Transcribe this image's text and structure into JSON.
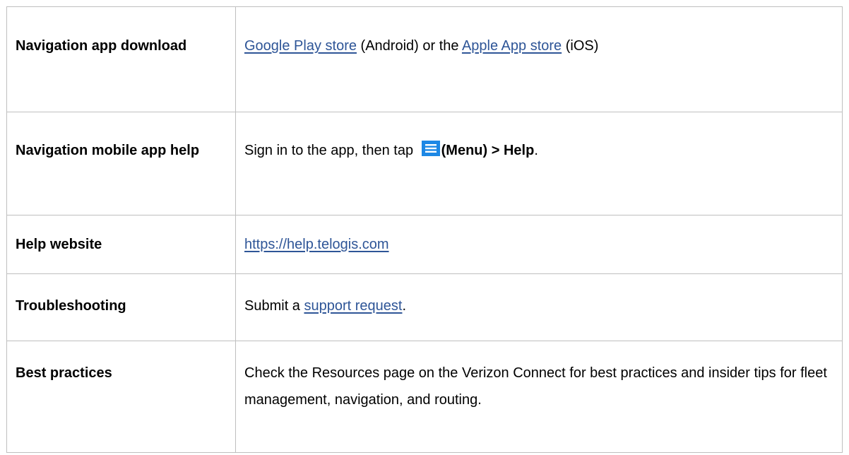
{
  "rows": [
    {
      "label": "Navigation app download",
      "link1": "Google Play store",
      "text1": " (Android) or the ",
      "link2": "Apple App store",
      "text2": " (iOS)"
    },
    {
      "label": "Navigation mobile app help",
      "text1": "Sign in to the app, then tap ",
      "icon": "menu-icon",
      "bold1": "(Menu) > Help",
      "text2": "."
    },
    {
      "label": "Help website",
      "link1": " https://help.telogis.com"
    },
    {
      "label": "Troubleshooting",
      "text1": "Submit a ",
      "link1": "support request",
      "text2": "."
    },
    {
      "label": "Best practices",
      "text1": "Check the Resources page on the Verizon Connect for best practices and insider tips for fleet management, navigation, and routing."
    }
  ],
  "colors": {
    "link": "#2e5597",
    "border": "#bfbfbf",
    "menu_icon": "#1e88e5"
  }
}
